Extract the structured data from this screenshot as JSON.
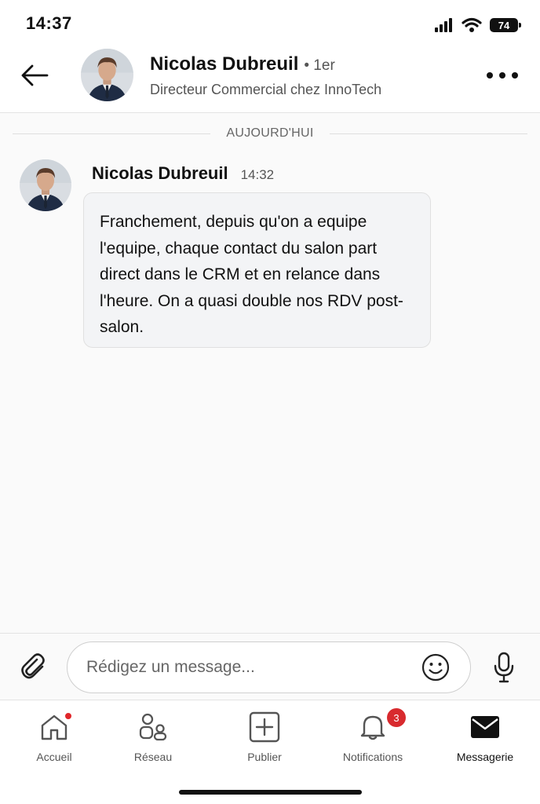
{
  "status_bar": {
    "time": "14:37",
    "battery": "74"
  },
  "header": {
    "name": "Nicolas Dubreuil",
    "degree": "• 1er",
    "title": "Directeur Commercial chez InnoTech"
  },
  "conversation": {
    "date_divider": "AUJOURD'HUI",
    "messages": [
      {
        "sender": "Nicolas Dubreuil",
        "time": "14:32",
        "text": "Franchement, depuis qu'on a equipe l'equipe, chaque contact du salon part direct dans le CRM et en relance dans l'heure. On a quasi double nos RDV post-salon."
      }
    ]
  },
  "composer": {
    "placeholder": "Rédigez un message..."
  },
  "nav": {
    "items": [
      {
        "label": "Accueil",
        "icon": "home-icon",
        "has_dot": true
      },
      {
        "label": "Réseau",
        "icon": "network-icon"
      },
      {
        "label": "Publier",
        "icon": "post-icon"
      },
      {
        "label": "Notifications",
        "icon": "bell-icon",
        "badge": "3"
      },
      {
        "label": "Messagerie",
        "icon": "messaging-icon",
        "active": true
      }
    ]
  },
  "colors": {
    "badge": "#d82a2e",
    "bubble_bg": "#f3f4f6",
    "text": "#111111"
  }
}
